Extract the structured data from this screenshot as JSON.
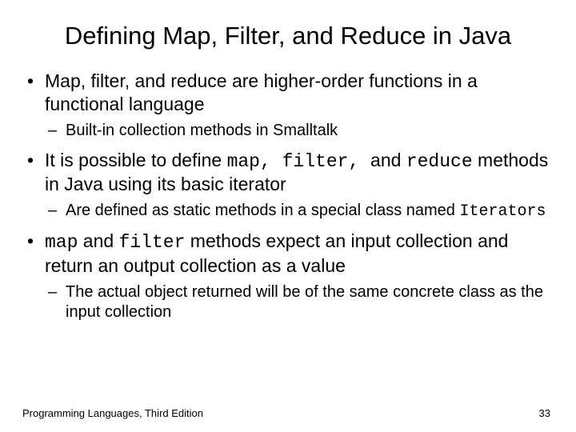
{
  "title": "Defining Map, Filter, and Reduce in Java",
  "b1": "Map, filter, and reduce are higher-order functions in a functional language",
  "s1": "Built-in collection methods in Smalltalk",
  "b2a": "It is possible to define ",
  "b2_map": "map",
  "b2_sep": ", ",
  "b2_filter": "filter",
  "b2_sep2": ", ",
  "b2b": "and ",
  "b2_reduce": "reduce",
  "b2c": " methods in Java using its basic iterator",
  "s2a": "Are defined as static methods in a special class named ",
  "s2_iter": "Iterators",
  "b3_map": "map",
  "b3a": " and ",
  "b3_filter": "filter",
  "b3b": " methods expect an input collection and return an output collection as a value",
  "s3": "The actual object returned will be of the same concrete class as the input collection",
  "footer_left": "Programming Languages, Third Edition",
  "footer_right": "33"
}
